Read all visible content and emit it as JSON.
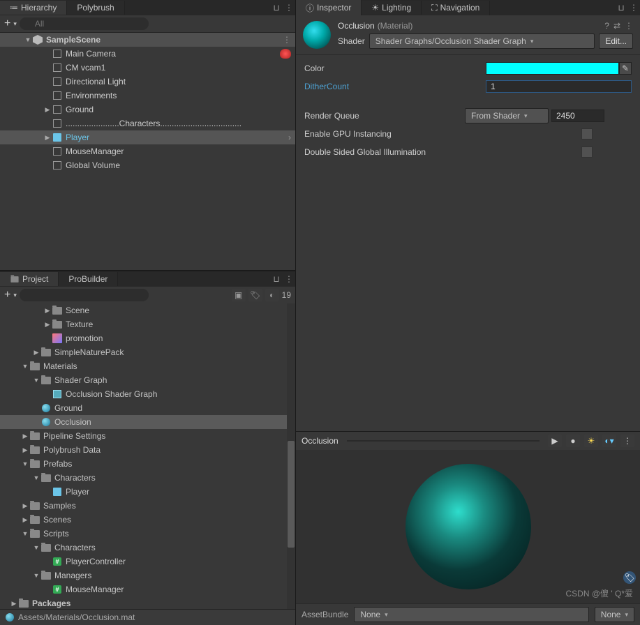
{
  "hierarchy": {
    "tabs": [
      "Hierarchy",
      "Polybrush"
    ],
    "search_placeholder": "All",
    "scene": "SampleScene",
    "items": [
      {
        "name": "Main Camera",
        "indent": 2,
        "bug": true
      },
      {
        "name": "CM vcam1",
        "indent": 2
      },
      {
        "name": "Directional Light",
        "indent": 2
      },
      {
        "name": "Environments",
        "indent": 2
      },
      {
        "name": "Ground",
        "indent": 2,
        "arrow": true
      },
      {
        "name": ".......................Characters...................................",
        "indent": 2
      },
      {
        "name": "Player",
        "indent": 2,
        "arrow": true,
        "selected": true,
        "prefab": true
      },
      {
        "name": "MouseManager",
        "indent": 2
      },
      {
        "name": "Global Volume",
        "indent": 2
      }
    ]
  },
  "project": {
    "tabs": [
      "Project",
      "ProBuilder"
    ],
    "hidden_count": "19",
    "items": [
      {
        "name": "Scene",
        "indent": 3,
        "type": "folder",
        "arrow": true
      },
      {
        "name": "Texture",
        "indent": 3,
        "type": "folder",
        "arrow": true
      },
      {
        "name": "promotion",
        "indent": 3,
        "type": "image"
      },
      {
        "name": "SimpleNaturePack",
        "indent": 2,
        "type": "folder",
        "arrow": true
      },
      {
        "name": "Materials",
        "indent": 1,
        "type": "folder",
        "arrow": true,
        "expanded": true
      },
      {
        "name": "Shader Graph",
        "indent": 2,
        "type": "folder",
        "arrow": true,
        "expanded": true
      },
      {
        "name": "Occlusion Shader Graph",
        "indent": 3,
        "type": "shader"
      },
      {
        "name": "Ground",
        "indent": 2,
        "type": "material"
      },
      {
        "name": "Occlusion",
        "indent": 2,
        "type": "material",
        "selected": true
      },
      {
        "name": "Pipeline Settings",
        "indent": 1,
        "type": "folder",
        "arrow": true
      },
      {
        "name": "Polybrush Data",
        "indent": 1,
        "type": "folder",
        "arrow": true
      },
      {
        "name": "Prefabs",
        "indent": 1,
        "type": "folder",
        "arrow": true,
        "expanded": true
      },
      {
        "name": "Characters",
        "indent": 2,
        "type": "folder",
        "arrow": true,
        "expanded": true
      },
      {
        "name": "Player",
        "indent": 3,
        "type": "prefab"
      },
      {
        "name": "Samples",
        "indent": 1,
        "type": "folder",
        "arrow": true
      },
      {
        "name": "Scenes",
        "indent": 1,
        "type": "folder",
        "arrow": true
      },
      {
        "name": "Scripts",
        "indent": 1,
        "type": "folder",
        "arrow": true,
        "expanded": true
      },
      {
        "name": "Characters",
        "indent": 2,
        "type": "folder",
        "arrow": true,
        "expanded": true
      },
      {
        "name": "PlayerController",
        "indent": 3,
        "type": "script"
      },
      {
        "name": "Managers",
        "indent": 2,
        "type": "folder",
        "arrow": true,
        "expanded": true
      },
      {
        "name": "MouseManager",
        "indent": 3,
        "type": "script"
      },
      {
        "name": "Packages",
        "indent": 0,
        "type": "folder",
        "arrow": true,
        "bold": true
      }
    ],
    "status_path": "Assets/Materials/Occlusion.mat"
  },
  "inspector": {
    "tabs": [
      "Inspector",
      "Lighting",
      "Navigation"
    ],
    "title": "Occlusion",
    "title_type": "(Material)",
    "shader_label": "Shader",
    "shader_value": "Shader Graphs/Occlusion Shader Graph",
    "edit_btn": "Edit...",
    "props": {
      "color_label": "Color",
      "color_value": "#00FFFF",
      "dither_label": "DitherCount",
      "dither_value": "1",
      "queue_label": "Render Queue",
      "queue_mode": "From Shader",
      "queue_value": "2450",
      "gpu_label": "Enable GPU Instancing",
      "dsgi_label": "Double Sided Global Illumination"
    },
    "preview_title": "Occlusion",
    "assetbundle_label": "AssetBundle",
    "assetbundle_value": "None",
    "assetbundle_variant": "None",
    "watermark": "CSDN @傻 ' Q*爱"
  }
}
